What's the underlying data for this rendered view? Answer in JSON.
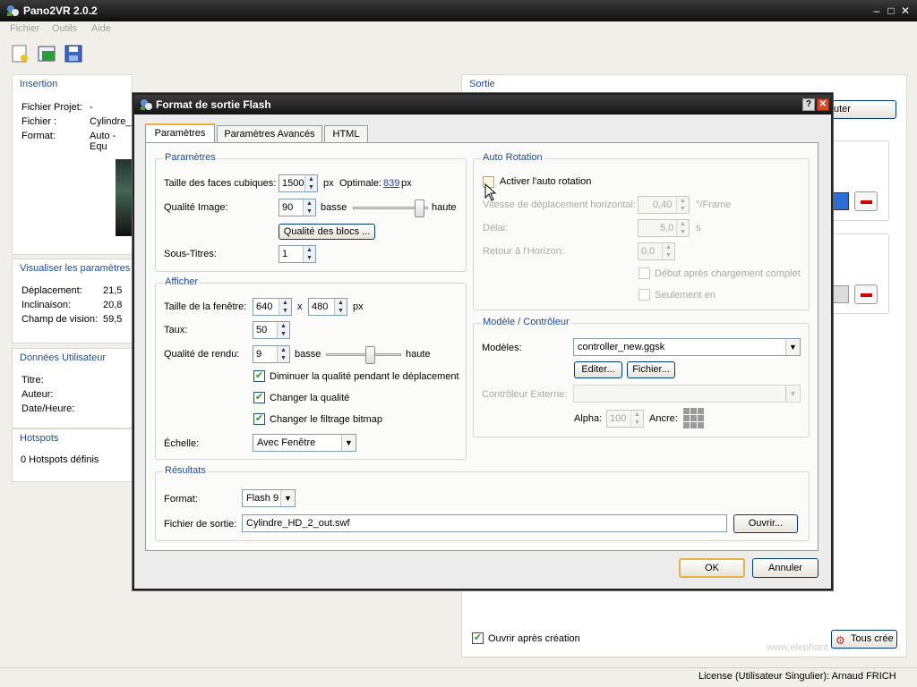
{
  "app": {
    "title": "Pano2VR 2.0.2",
    "menu": [
      "Fichier",
      "Outils",
      "Aide"
    ]
  },
  "insertion": {
    "title": "Insertion",
    "fichier_projet_label": "Fichier Projet:",
    "fichier_projet_value": "-",
    "fichier_label": "Fichier :",
    "fichier_value": "Cylindre_H",
    "format_label": "Format:",
    "format_value": "Auto - Equ"
  },
  "visualiser": {
    "title": "Visualiser les paramètres",
    "deplacement_label": "Déplacement:",
    "deplacement_value": "21,5",
    "inclinaison_label": "Inclinaison:",
    "inclinaison_value": "20,8",
    "champ_label": "Champ de vision:",
    "champ_value": "59,5"
  },
  "donnees": {
    "title": "Données Utilisateur",
    "titre_label": "Titre:",
    "auteur_label": "Auteur:",
    "date_label": "Date/Heure:"
  },
  "hotspots": {
    "title": "Hotspots",
    "count_text": "0 Hotspots définis"
  },
  "sortie": {
    "title": "Sortie",
    "ajouter_label": "uter",
    "ouvrir_label": "Ouvrir après création",
    "tous_label": "Tous crée"
  },
  "status": {
    "license": "License (Utilisateur Singulier): Arnaud FRICH"
  },
  "watermark": "www.elephant.com",
  "dialog": {
    "title": "Format de sortie Flash",
    "tabs": [
      "Paramètres",
      "Paramètres Avancés",
      "HTML"
    ],
    "parametres": {
      "title": "Paramètres",
      "faces_label": "Taille des faces cubiques:",
      "faces_value": "1500",
      "faces_unit": "px",
      "optimale_label": "Optimale:",
      "optimale_value": "839",
      "optimale_unit": "px",
      "qualite_label": "Qualité Image:",
      "qualite_value": "90",
      "basse": "basse",
      "haute": "haute",
      "qualite_level": 0.95,
      "blocs_btn": "Qualité des blocs ...",
      "soustitres_label": "Sous-Titres:",
      "soustitres_value": "1"
    },
    "afficher": {
      "title": "Afficher",
      "taille_label": "Taille de la fenêtre:",
      "width": "640",
      "x": "x",
      "height": "480",
      "unit": "px",
      "taux_label": "Taux:",
      "taux_value": "50",
      "rendu_label": "Qualité de rendu:",
      "rendu_value": "9",
      "basse": "basse",
      "haute": "haute",
      "rendu_level": 0.6,
      "chk1": "Diminuer la qualité pendant le déplacement",
      "chk2": "Changer la qualité",
      "chk3": "Changer le filtrage bitmap",
      "echelle_label": "Échelle:",
      "echelle_value": "Avec Fenêtre"
    },
    "auto_rotation": {
      "title": "Auto Rotation",
      "activer": "Activer l'auto rotation",
      "vitesse_label": "Vitesse de déplacement horizontal:",
      "vitesse_value": "0,40",
      "vitesse_unit": "°/Frame",
      "delai_label": "Délai:",
      "delai_value": "5,0",
      "delai_unit": "s",
      "retour_label": "Retour à l'Horizon:",
      "retour_value": "0,0",
      "debut": "Début après chargement complet",
      "seulement": "Seulement en"
    },
    "modele": {
      "title": "Modèle / Contrôleur",
      "modeles_label": "Modèles:",
      "modeles_value": "controller_new.ggsk",
      "editer_btn": "Editer...",
      "fichier_btn": "Fichier...",
      "externe_label": "Contrôleur Externe:",
      "alpha_label": "Alpha:",
      "alpha_value": "100",
      "ancre_label": "Ancre:"
    },
    "resultats": {
      "title": "Résultats",
      "format_label": "Format:",
      "format_value": "Flash 9",
      "fichier_label": "Fichier de sortie:",
      "fichier_value": "Cylindre_HD_2_out.swf",
      "ouvrir_btn": "Ouvrir..."
    },
    "ok": "OK",
    "annuler": "Annuler"
  }
}
